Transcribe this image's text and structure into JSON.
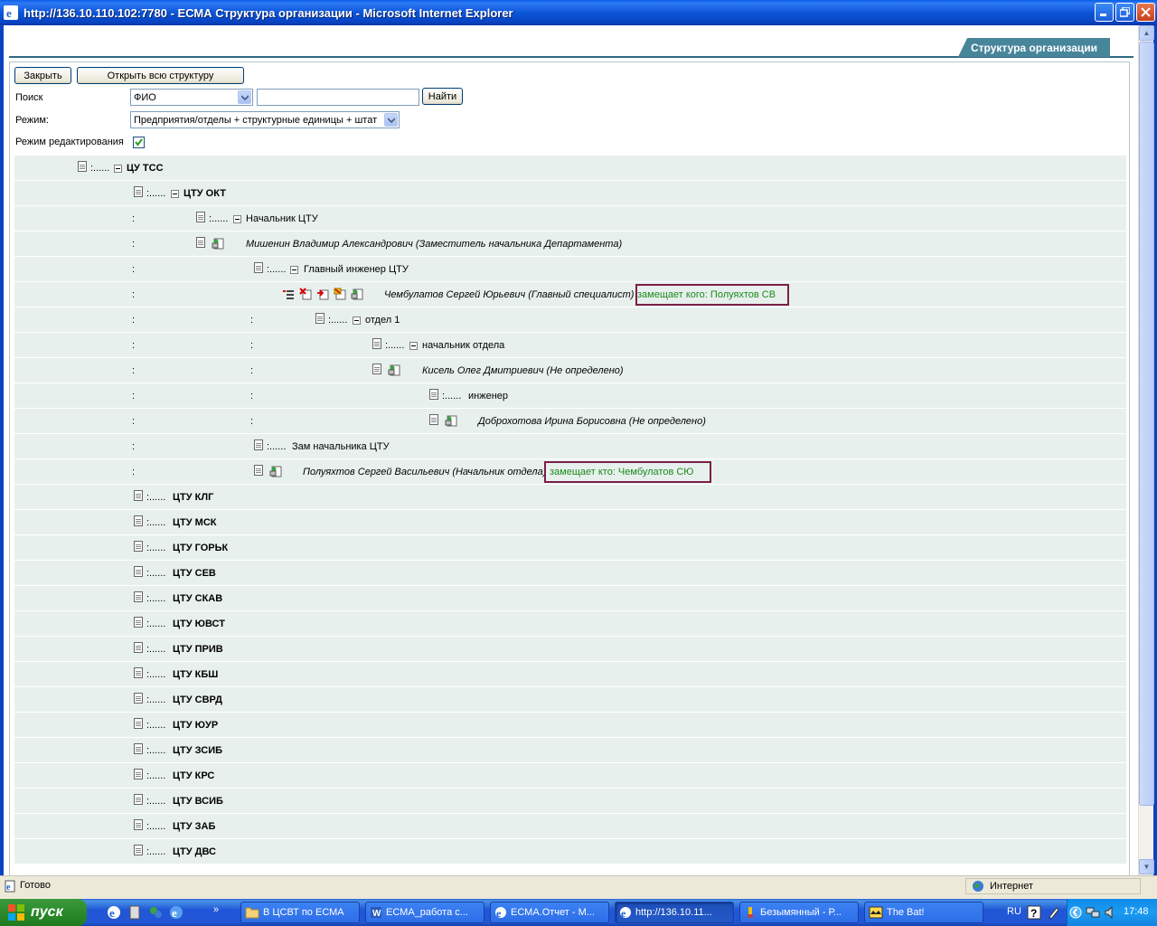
{
  "window": {
    "title": "http://136.10.110.102:7780 - ЕСМА Структура организации - Microsoft Internet Explorer"
  },
  "tab": {
    "label": "Структура организации"
  },
  "toolbar": {
    "close_label": "Закрыть",
    "open_all_label": "Открыть всю структуру"
  },
  "search": {
    "label": "Поиск",
    "field_value": "ФИО",
    "query_value": "",
    "find_label": "Найти"
  },
  "mode": {
    "label": "Режим:",
    "value": "Предприятия/отделы + структурные единицы + штат"
  },
  "edit_mode": {
    "label": "Режим редактирования",
    "checked": true
  },
  "tree": {
    "dots": ":......",
    "colon": ":",
    "nodes": {
      "ctu_tss": "ЦУ ТСС",
      "ctu_okt": "ЦТУ ОКТ",
      "head_ctu": "Начальник ЦТУ",
      "mishenin": "Мишенин Владимир Александрович (Заместитель начальника Департамента)",
      "chief_eng": "Главный инженер ЦТУ",
      "chembulatov": "Чембулатов Сергей Юрьевич (Главный специалист)",
      "chembulatov_repl": "замещает кого: Полуяхтов СВ",
      "dept1": "отдел 1",
      "head_dept": "начальник отдела",
      "kisel": "Кисель Олег Дмитриевич (Не определено)",
      "engineer": "инженер",
      "dobrokhotova": "Доброхотова Ирина Борисовна (Не определено)",
      "deputy_head": "Зам начальника ЦТУ",
      "poluyakhtov": "Полуяхтов Сергей Васильевич (Начальник отдела)",
      "poluyakhtov_repl": "замещает кто: Чембулатов СЮ"
    },
    "collapsed": [
      "ЦТУ КЛГ",
      "ЦТУ МСК",
      "ЦТУ ГОРЬК",
      "ЦТУ СЕВ",
      "ЦТУ СКАВ",
      "ЦТУ ЮВСТ",
      "ЦТУ ПРИВ",
      "ЦТУ КБШ",
      "ЦТУ СВРД",
      "ЦТУ ЮУР",
      "ЦТУ ЗСИБ",
      "ЦТУ КРС",
      "ЦТУ ВСИБ",
      "ЦТУ ЗАБ",
      "ЦТУ ДВС"
    ]
  },
  "status": {
    "text": "Готово",
    "zone": "Интернет"
  },
  "taskbar": {
    "start": "пуск",
    "tasks": [
      "В ЦСВТ по ЕСМА",
      "ЕСМА_работа с...",
      "ЕСМА.Отчет - М...",
      "http://136.10.11...",
      "Безымянный - Р...",
      "The Bat!"
    ],
    "lang": "RU",
    "clock": "17:48"
  },
  "colors": {
    "accent": "#47859a",
    "row_bg": "#e8f0ee",
    "replace_border": "#7a1f45",
    "replace_text": "#1a8a1a"
  }
}
